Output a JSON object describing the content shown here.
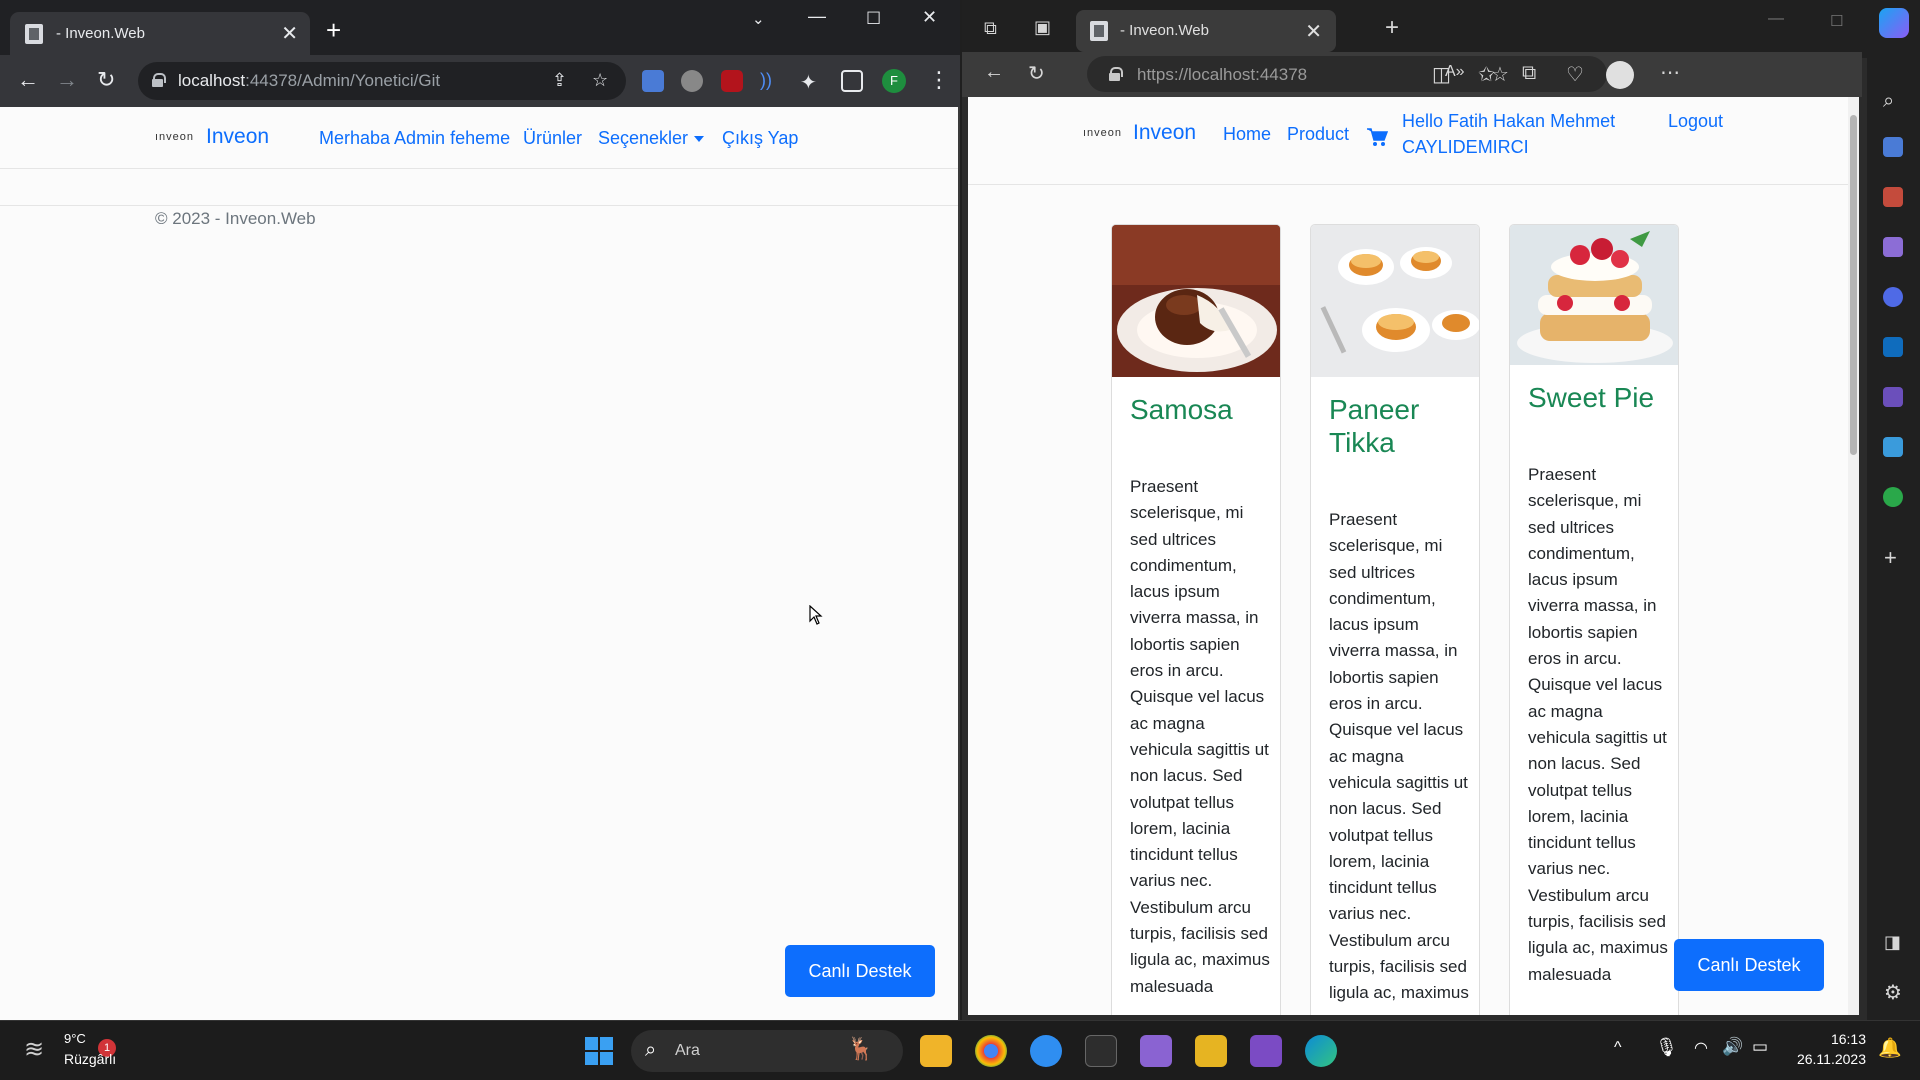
{
  "chrome": {
    "tab_title": "- Inveon.Web",
    "close_glyph": "✕",
    "newtab_glyph": "+",
    "url_host": "localhost",
    "url_path": ":44378/Admin/Yonetici/Git",
    "profile_initial": "F",
    "page": {
      "brand_small": "ınveon",
      "brand": "Inveon",
      "nav": [
        "Merhaba Admin feheme",
        "Ürünler",
        "Seçenekler",
        "Çıkış Yap"
      ],
      "footer": "© 2023 - Inveon.Web",
      "support_button": "Canlı Destek"
    }
  },
  "edge": {
    "tab_title": "- Inveon.Web",
    "close_glyph": "✕",
    "newtab_glyph": "+",
    "url": "https://localhost:44378",
    "page": {
      "brand_small": "ınveon",
      "brand": "Inveon",
      "nav_home": "Home",
      "nav_product": "Product",
      "greeting_line1": "Hello Fatih Hakan Mehmet",
      "greeting_line2": "CAYLIDEMIRCI",
      "logout": "Logout",
      "support_button": "Canlı Destek",
      "products": [
        {
          "name": "Samosa",
          "text": "Praesent scelerisque, mi sed ultrices condimentum, lacus ipsum viverra massa, in lobortis sapien eros in arcu. Quisque vel lacus ac magna vehicula sagittis ut non lacus. Sed volutpat tellus lorem, lacinia tincidunt tellus varius nec. Vestibulum arcu turpis, facilisis sed ligula ac, maximus malesuada"
        },
        {
          "name": "Paneer Tikka",
          "text": "Praesent scelerisque, mi sed ultrices condimentum, lacus ipsum viverra massa, in lobortis sapien eros in arcu. Quisque vel lacus ac magna vehicula sagittis ut non lacus. Sed volutpat tellus lorem, lacinia tincidunt tellus varius nec. Vestibulum arcu turpis, facilisis sed ligula ac, maximus"
        },
        {
          "name": "Sweet Pie",
          "text": "Praesent scelerisque, mi sed ultrices condimentum, lacus ipsum viverra massa, in lobortis sapien eros in arcu. Quisque vel lacus ac magna vehicula sagittis ut non lacus. Sed volutpat tellus lorem, lacinia tincidunt tellus varius nec. Vestibulum arcu turpis, facilisis sed ligula ac, maximus malesuada"
        }
      ]
    }
  },
  "taskbar": {
    "weather_temp": "9°C",
    "weather_desc": "Rüzgârlı",
    "weather_badge": "1",
    "search_placeholder": "Ara",
    "time": "16:13",
    "date": "26.11.2023"
  },
  "colors": {
    "link": "#0d6efd",
    "card_title": "#198754",
    "button": "#0d6efd"
  }
}
